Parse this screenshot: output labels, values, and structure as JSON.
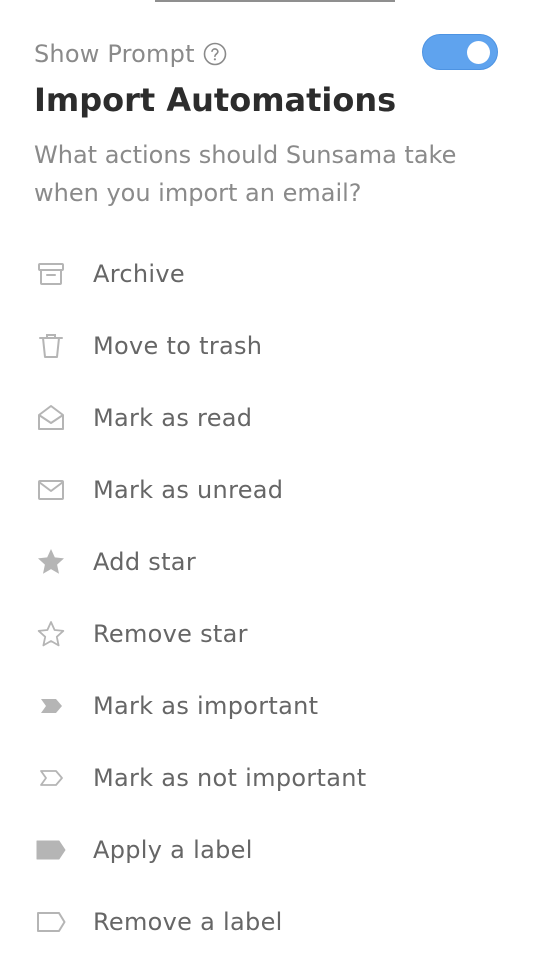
{
  "header": {
    "show_prompt_label": "Show Prompt",
    "help_icon": "question-circle-icon",
    "toggle_on": true,
    "title": "Import Automations",
    "subtitle": "What actions should Sunsama take when you import an email?"
  },
  "colors": {
    "toggle": "#5fa3ee",
    "title": "#2c2c2c",
    "text": "#8a8a8a",
    "icon": "#b5b5b5"
  },
  "actions": [
    {
      "label": "Archive",
      "icon": "archive-icon"
    },
    {
      "label": "Move to trash",
      "icon": "trash-icon"
    },
    {
      "label": "Mark as read",
      "icon": "envelope-open-icon"
    },
    {
      "label": "Mark as unread",
      "icon": "envelope-icon"
    },
    {
      "label": "Add star",
      "icon": "star-filled-icon"
    },
    {
      "label": "Remove star",
      "icon": "star-outline-icon"
    },
    {
      "label": "Mark as important",
      "icon": "important-filled-icon"
    },
    {
      "label": "Mark as not important",
      "icon": "important-outline-icon"
    },
    {
      "label": "Apply a label",
      "icon": "label-filled-icon"
    },
    {
      "label": "Remove a label",
      "icon": "label-outline-icon"
    }
  ]
}
